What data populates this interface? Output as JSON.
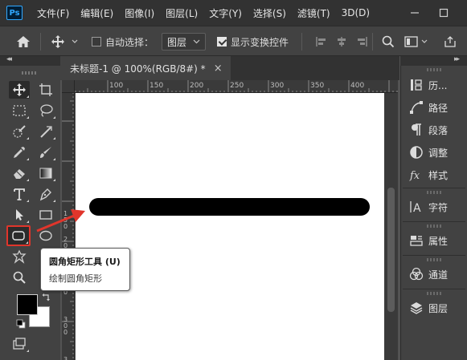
{
  "app": {
    "logo": "Ps"
  },
  "menu": [
    "文件(F)",
    "编辑(E)",
    "图像(I)",
    "图层(L)",
    "文字(Y)",
    "选择(S)",
    "滤镜(T)",
    "3D(D)"
  ],
  "options": {
    "auto_select_label": "自动选择：",
    "auto_select_checked": false,
    "layer_dropdown_value": "图层",
    "show_transform_label": "显示变换控件",
    "show_transform_checked": true
  },
  "document": {
    "tab_title": "未标题-1 @ 100%(RGB/8#) *",
    "close_glyph": "×",
    "ruler_top_ticks": [
      "100",
      "150",
      "200",
      "250",
      "300",
      "350",
      "400"
    ],
    "ruler_left_ticks": [
      "1",
      "5",
      "0",
      "2",
      "0",
      "0",
      "2",
      "5",
      "0",
      "3",
      "0",
      "0",
      "3",
      "5"
    ]
  },
  "tooltip": {
    "title": "圆角矩形工具 (U)",
    "description": "绘制圆角矩形"
  },
  "panels": [
    {
      "label": "历...",
      "icon": "history-icon"
    },
    {
      "label": "路径",
      "icon": "paths-icon"
    },
    {
      "label": "段落",
      "icon": "paragraph-icon"
    },
    {
      "label": "调整",
      "icon": "adjustments-icon"
    },
    {
      "label": "样式",
      "icon": "styles-icon"
    },
    {
      "label": "字符",
      "icon": "character-icon"
    },
    {
      "label": "属性",
      "icon": "properties-icon"
    },
    {
      "label": "通道",
      "icon": "channels-icon"
    },
    {
      "label": "图层",
      "icon": "layers-icon"
    }
  ],
  "colors": {
    "foreground": "#000000",
    "background": "#ffffff",
    "highlight": "#e0352b",
    "drawn_shape": "#000000"
  }
}
